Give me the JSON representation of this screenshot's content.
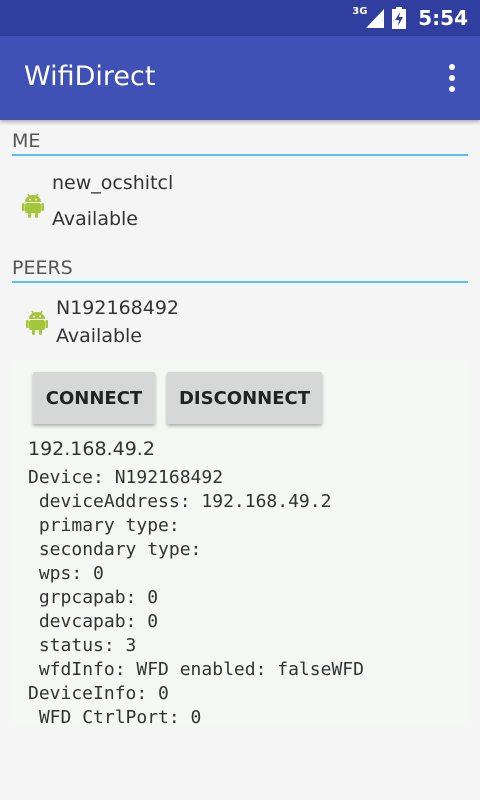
{
  "status_bar": {
    "network": "3G",
    "time": "5:54"
  },
  "app_bar": {
    "title": "WifiDirect",
    "menu_icon": "more-vert-icon"
  },
  "me": {
    "header": "ME",
    "device": {
      "name": "new_ocshitcl",
      "status": "Available",
      "icon": "android-icon"
    }
  },
  "peers": {
    "header": "PEERS",
    "device": {
      "name": "N192168492",
      "status": "Available",
      "icon": "android-icon"
    }
  },
  "detail": {
    "connect_label": "CONNECT",
    "disconnect_label": "DISCONNECT",
    "ip": "192.168.49.2",
    "info": "Device: N192168492\n deviceAddress: 192.168.49.2\n primary type: \n secondary type: \n wps: 0\n grpcapab: 0\n devcapab: 0\n status: 3\n wfdInfo: WFD enabled: falseWFD DeviceInfo: 0\n WFD CtrlPort: 0"
  },
  "colors": {
    "status_bar": "#303F9F",
    "app_bar": "#3F51B5",
    "accent": "#4FC3F7",
    "android_green": "#A4C639"
  }
}
